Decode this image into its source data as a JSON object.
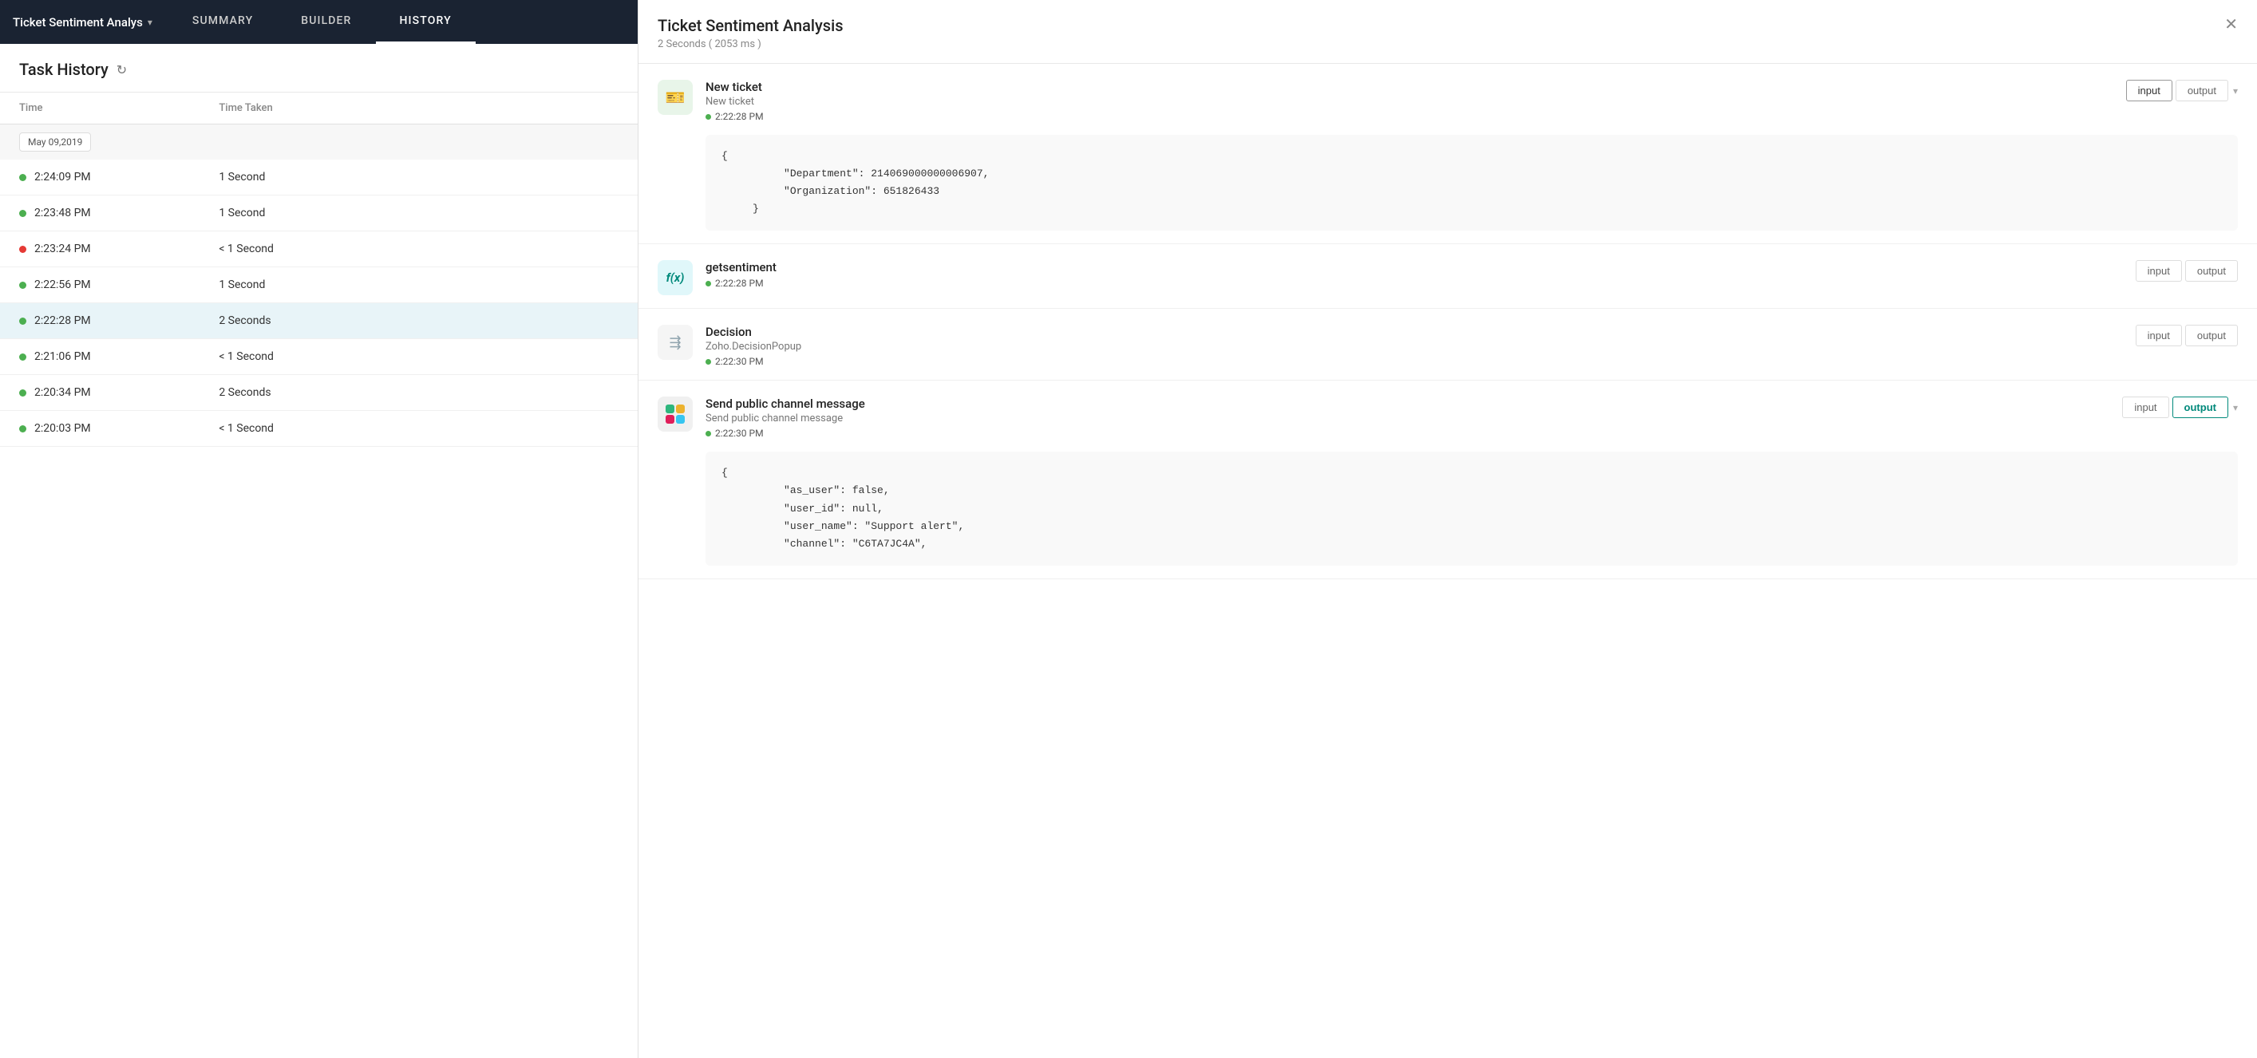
{
  "app": {
    "title": "Ticket Sentiment Analys",
    "tabs": [
      {
        "label": "SUMMARY",
        "active": false
      },
      {
        "label": "BUILDER",
        "active": false
      },
      {
        "label": "HISTORY",
        "active": true
      }
    ]
  },
  "left": {
    "task_history_title": "Task History",
    "table_headers": [
      "Time",
      "Time Taken",
      ""
    ],
    "date_badge": "May 09,2019",
    "rows": [
      {
        "time": "2:24:09 PM",
        "time_taken": "1 Second",
        "status": "green",
        "selected": false
      },
      {
        "time": "2:23:48 PM",
        "time_taken": "1 Second",
        "status": "green",
        "selected": false
      },
      {
        "time": "2:23:24 PM",
        "time_taken": "< 1 Second",
        "status": "red",
        "selected": false
      },
      {
        "time": "2:22:56 PM",
        "time_taken": "1 Second",
        "status": "green",
        "selected": false
      },
      {
        "time": "2:22:28 PM",
        "time_taken": "2 Seconds",
        "status": "green",
        "selected": true
      },
      {
        "time": "2:21:06 PM",
        "time_taken": "< 1 Second",
        "status": "green",
        "selected": false
      },
      {
        "time": "2:20:34 PM",
        "time_taken": "2 Seconds",
        "status": "green",
        "selected": false
      },
      {
        "time": "2:20:03 PM",
        "time_taken": "< 1 Second",
        "status": "green",
        "selected": false
      }
    ]
  },
  "right": {
    "title": "Ticket Sentiment Analysis",
    "subtitle": "2 Seconds ( 2053 ms )",
    "steps": [
      {
        "id": "new-ticket",
        "icon_type": "ticket",
        "name": "New ticket",
        "subname": "New ticket",
        "time": "2:22:28 PM",
        "input_active": true,
        "output_active": false,
        "has_content": true,
        "content": "{\n          \"Department\": 214069000000006907,\n          \"Organization\": 651826433\n     }"
      },
      {
        "id": "getsentiment",
        "icon_type": "function",
        "name": "getsentiment",
        "subname": "",
        "time": "2:22:28 PM",
        "input_active": false,
        "output_active": false,
        "has_content": false,
        "content": ""
      },
      {
        "id": "decision",
        "icon_type": "decision",
        "name": "Decision",
        "subname": "Zoho.DecisionPopup",
        "time": "2:22:30 PM",
        "input_active": false,
        "output_active": false,
        "has_content": false,
        "content": ""
      },
      {
        "id": "send-public",
        "icon_type": "slack",
        "name": "Send public channel message",
        "subname": "Send public channel message",
        "time": "2:22:30 PM",
        "input_active": false,
        "output_active": true,
        "has_content": true,
        "content": "{\n          \"as_user\": false,\n          \"user_id\": null,\n          \"user_name\": \"Support alert\",\n          \"channel\": \"C6TA7JC4A\","
      }
    ],
    "btn_input": "input",
    "btn_output": "output"
  }
}
